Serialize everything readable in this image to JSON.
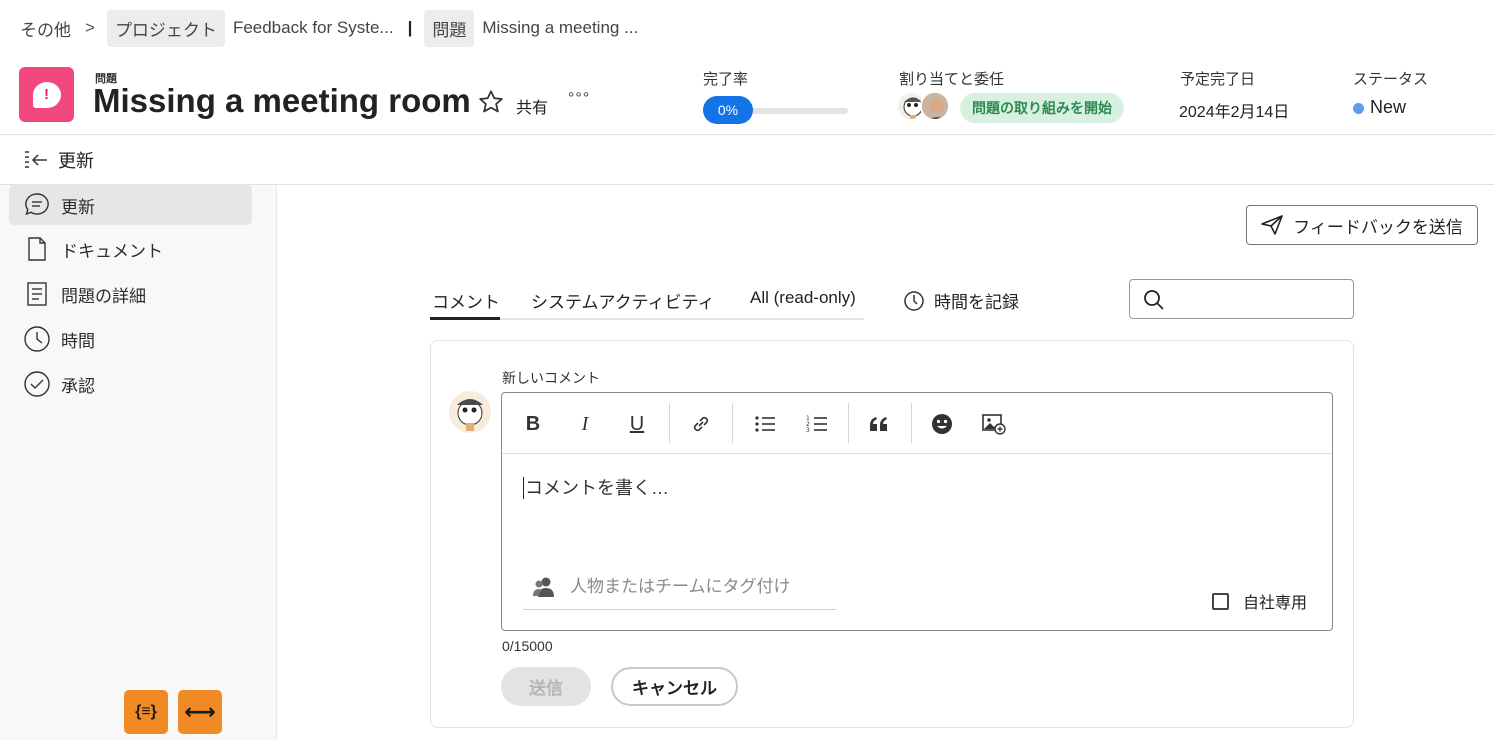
{
  "breadcrumb": {
    "items": [
      "その他",
      "プロジェクト",
      "Feedback for Syste...",
      "問題",
      "Missing a meeting ..."
    ],
    "separator": ">",
    "divider": "|"
  },
  "header": {
    "object_type": "問題",
    "title": "Missing a meeting room",
    "share_label": "共有",
    "more_label": "°°°",
    "completion_label": "完了率",
    "completion_value": "0%",
    "completion_fraction": 0,
    "assign_label": "割り当てと委任",
    "assign_badge": "問題の取り組みを開始",
    "due_label": "予定完了日",
    "due_value": "2024年2月14日",
    "status_label": "ステータス",
    "status_value": "New",
    "status_color": "#5e9cf5",
    "icon_color": "#f1497d"
  },
  "section": {
    "title": "更新"
  },
  "sidebar": {
    "items": [
      {
        "label": "更新",
        "icon": "comment-icon",
        "active": true
      },
      {
        "label": "ドキュメント",
        "icon": "document-icon",
        "active": false
      },
      {
        "label": "問題の詳細",
        "icon": "details-icon",
        "active": false
      },
      {
        "label": "時間",
        "icon": "clock-icon",
        "active": false
      },
      {
        "label": "承認",
        "icon": "check-circle-icon",
        "active": false
      }
    ],
    "dev_buttons": [
      "{≡}",
      "⟷"
    ],
    "dev_color": "#f08a24"
  },
  "main": {
    "feedback_button": "フィードバックを送信",
    "tabs": [
      "コメント",
      "システムアクティビティ",
      "All (read-only)"
    ],
    "log_time": "時間を記録",
    "search": {
      "value": "",
      "placeholder": ""
    },
    "comment": {
      "label": "新しいコメント",
      "placeholder": "コメントを書く…",
      "tag_placeholder": "人物またはチームにタグ付け",
      "internal_label": "自社専用",
      "char_count": "0/15000",
      "send": "送信",
      "cancel": "キャンセル",
      "toolbar": [
        "B",
        "I",
        "U"
      ]
    }
  }
}
